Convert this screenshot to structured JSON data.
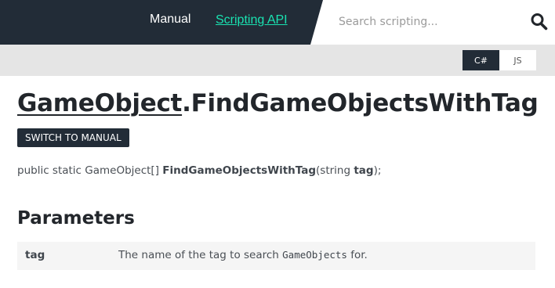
{
  "header": {
    "nav_manual": "Manual",
    "nav_scripting_api": "Scripting API",
    "search_placeholder": "Search scripting...",
    "search_icon": "search-icon",
    "accent_color": "#19e3b1",
    "dark_color": "#222c37"
  },
  "language_toggle": {
    "options": [
      "C#",
      "JS"
    ],
    "selected": "C#"
  },
  "page": {
    "title_class": "GameObject",
    "title_separator": ".",
    "title_member": "FindGameObjectsWithTag",
    "switch_button": "SWITCH TO MANUAL",
    "signature": {
      "prefix": "public static GameObject[] ",
      "method": "FindGameObjectsWithTag",
      "open": "(string ",
      "param": "tag",
      "close": ");"
    }
  },
  "parameters": {
    "heading": "Parameters",
    "rows": [
      {
        "name": "tag",
        "desc_before": "The name of the tag to search ",
        "desc_code": "GameObjects",
        "desc_after": " for."
      }
    ]
  }
}
